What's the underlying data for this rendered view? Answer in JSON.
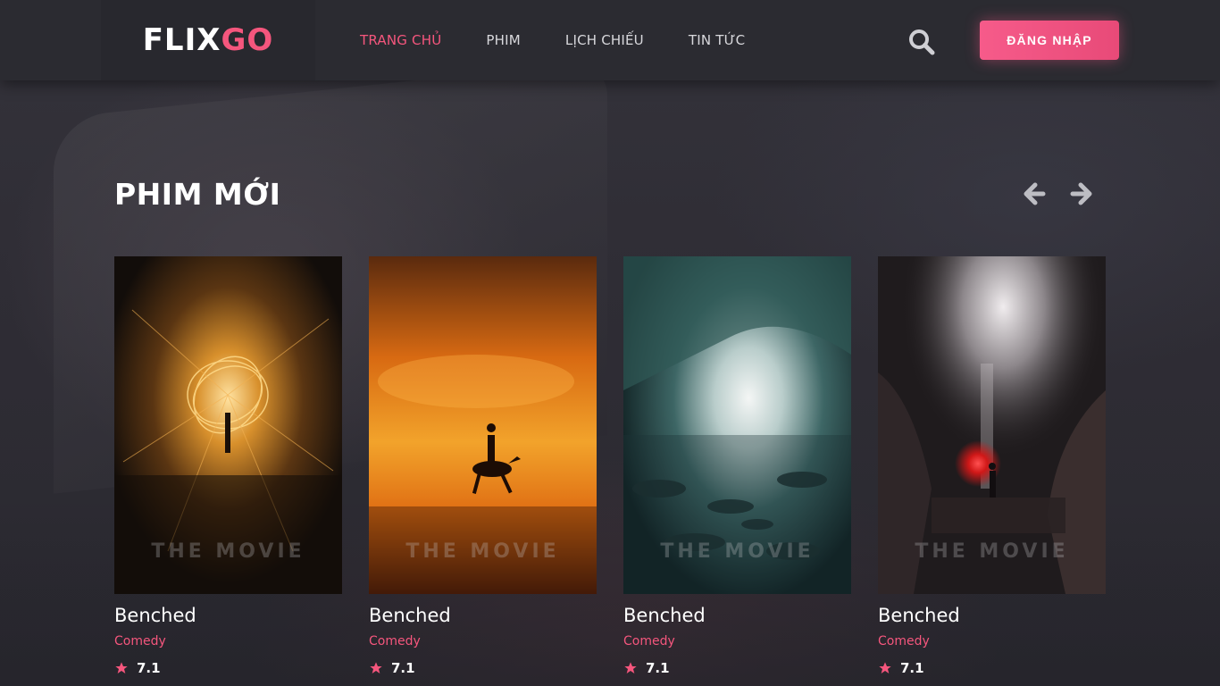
{
  "brand": {
    "part1": "FLIX",
    "part2": "GO"
  },
  "nav": [
    {
      "label": "TRANG CHỦ",
      "active": true
    },
    {
      "label": "PHIM",
      "active": false
    },
    {
      "label": "LỊCH CHIẾU",
      "active": false
    },
    {
      "label": "TIN TỨC",
      "active": false
    }
  ],
  "header": {
    "login_label": "ĐĂNG NHẬP",
    "search_icon": "search-icon"
  },
  "section": {
    "title": "PHIM MỚI",
    "prev_icon": "arrow-left-icon",
    "next_icon": "arrow-right-icon"
  },
  "movies": [
    {
      "title": "Benched",
      "genre": "Comedy",
      "rating": "7.1",
      "watermark": "THE MOVIE"
    },
    {
      "title": "Benched",
      "genre": "Comedy",
      "rating": "7.1",
      "watermark": "THE MOVIE"
    },
    {
      "title": "Benched",
      "genre": "Comedy",
      "rating": "7.1",
      "watermark": "THE MOVIE"
    },
    {
      "title": "Benched",
      "genre": "Comedy",
      "rating": "7.1",
      "watermark": "THE MOVIE"
    }
  ],
  "colors": {
    "accent": "#f5567d",
    "background": "#2b2a31",
    "header": "#2b2b31"
  }
}
